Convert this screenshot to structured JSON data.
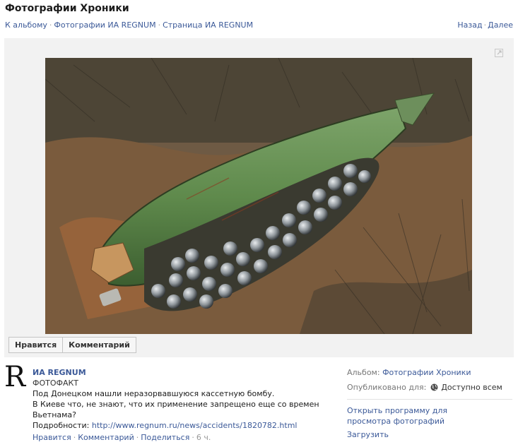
{
  "page": {
    "title": "Фотографии Хроники"
  },
  "breadcrumbs": {
    "album": "К альбому",
    "photos": "Фотографии ИА REGNUM",
    "page": "Страница ИА REGNUM"
  },
  "pager": {
    "back": "Назад",
    "next": "Далее"
  },
  "photo_controls": {
    "like": "Нравится",
    "comment": "Комментарий"
  },
  "post": {
    "avatar_letter": "R",
    "author": "ИА REGNUM",
    "tag": "ФОТОФАКТ",
    "lines": [
      "Под Донецком нашли неразорвавшуюся кассетную бомбу.",
      "В Киеве что, не знают, что их применение запрещено еще со времен Вьетнама?"
    ],
    "details_label": "Подробности:",
    "details_link": "http://www.regnum.ru/news/accidents/1820782.html",
    "actions": {
      "like": "Нравится",
      "comment": "Комментарий",
      "share": "Поделиться",
      "time": "6 ч."
    }
  },
  "sidebar": {
    "album_label": "Альбом:",
    "album_value": "Фотографии Хроники",
    "published_label": "Опубликовано для:",
    "published_value": "Доступно всем",
    "open_viewer": "Открыть программу для просмотра фотографий",
    "download": "Загрузить"
  },
  "icons": {
    "expand": "expand-icon",
    "globe": "globe-icon"
  },
  "colors": {
    "link": "#3b5998",
    "stage_bg": "#f2f2f2"
  }
}
